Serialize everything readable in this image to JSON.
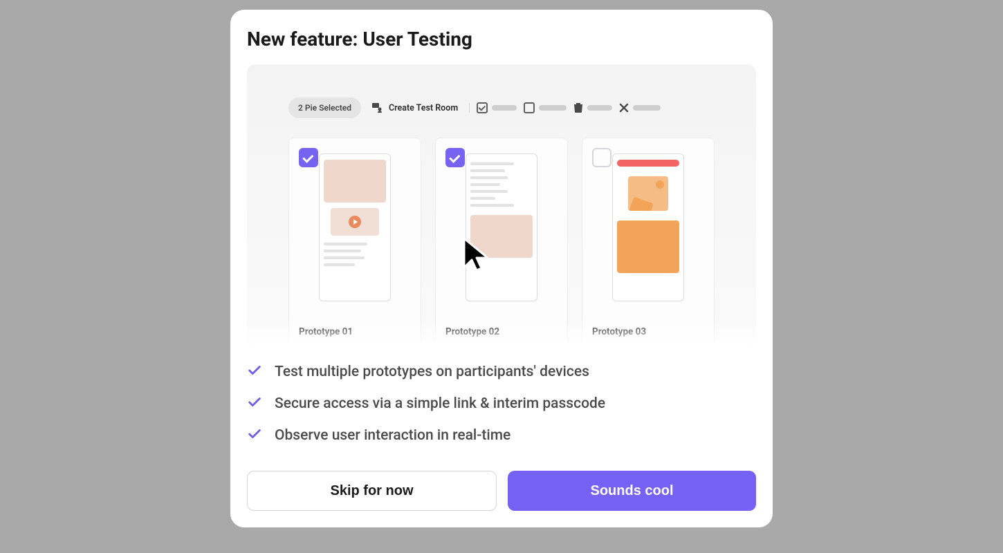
{
  "modal": {
    "title": "New feature: User Testing"
  },
  "illustration": {
    "selection_chip": "2 Pie Selected",
    "create_test_room_label": "Create Test Room",
    "proto1_name": "Prototype 01",
    "proto2_name": "Prototype 02",
    "proto3_name": "Prototype 03"
  },
  "bullets": {
    "b1": "Test multiple prototypes on participants' devices",
    "b2": "Secure access via a simple link & interim passcode",
    "b3": "Observe user interaction in real-time"
  },
  "actions": {
    "skip": "Skip for now",
    "confirm": "Sounds cool"
  }
}
